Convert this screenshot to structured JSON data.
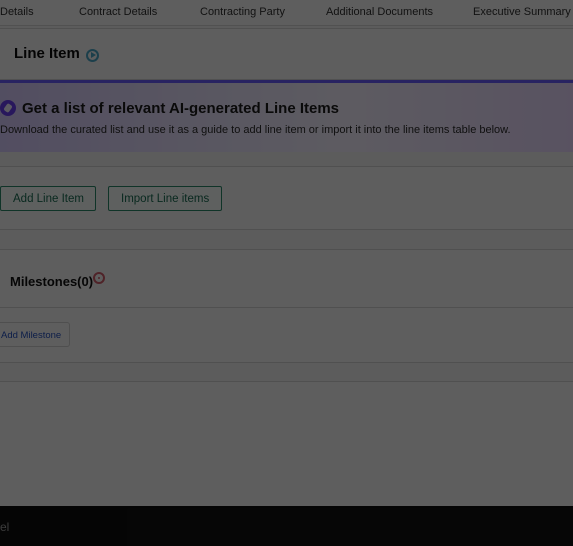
{
  "tabs": [
    {
      "label": "Details"
    },
    {
      "label": "Contract Details"
    },
    {
      "label": "Contracting Party"
    },
    {
      "label": "Additional Documents"
    },
    {
      "label": "Executive Summary"
    }
  ],
  "line_item": {
    "title": "Line Item",
    "icon": "play-circle-icon"
  },
  "ai_banner": {
    "title": "Get a list of relevant AI-generated Line Items",
    "subtitle": "Download the curated list and use it as a guide to add line item or import it into the line items table below.",
    "accent": "#6b5cff",
    "icon": "ai-spark-icon"
  },
  "actions": {
    "add_line_item": "Add Line Item",
    "import_line_items": "Import Line items",
    "button_color": "#2c8a69"
  },
  "milestones": {
    "title": "Milestones(0)",
    "icon": "milestone-status-icon"
  },
  "add_milestone": {
    "label": "Add Milestone",
    "color": "#234fbf"
  },
  "footer": {
    "text": "el"
  }
}
